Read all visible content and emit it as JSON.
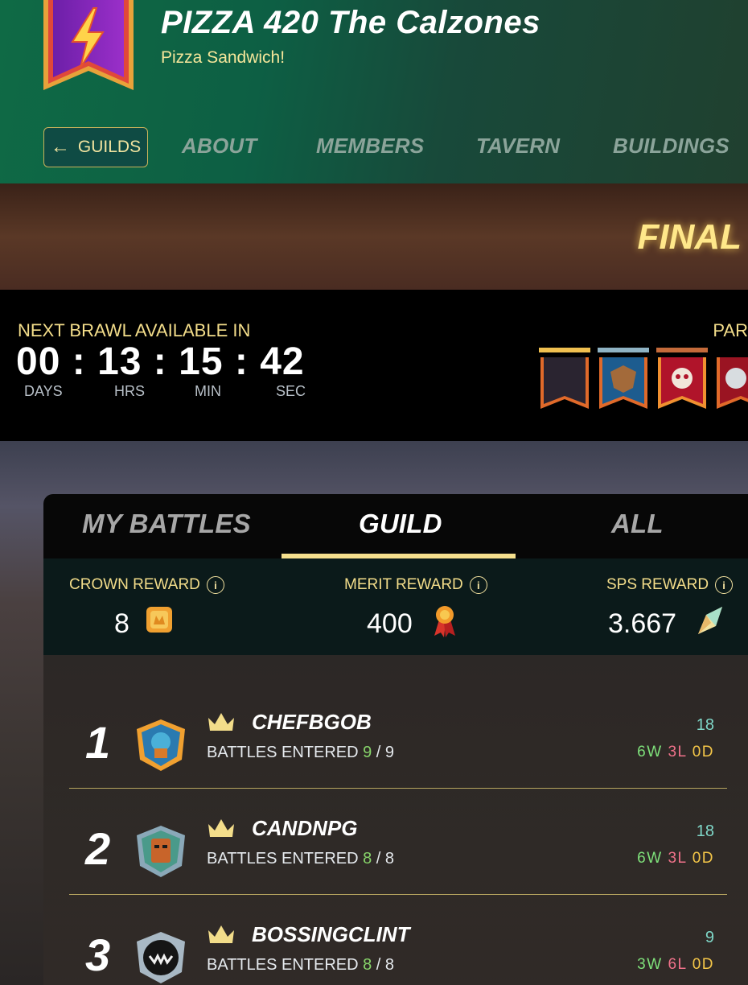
{
  "header": {
    "guild_name": "PIZZA 420 The Calzones",
    "motto": "Pizza Sandwich!",
    "back_label": "GUILDS",
    "nav": [
      "ABOUT",
      "MEMBERS",
      "TAVERN",
      "BUILDINGS"
    ]
  },
  "stage": {
    "label": "FINAL"
  },
  "timer": {
    "label": "NEXT BRAWL AVAILABLE IN",
    "days": "00",
    "hrs": "13",
    "min": "15",
    "sec": "42",
    "units": [
      "DAYS",
      "HRS",
      "MIN",
      "SEC"
    ],
    "participants_label": "PAR"
  },
  "tabs": {
    "items": [
      "MY BATTLES",
      "GUILD",
      "ALL"
    ],
    "active": "GUILD"
  },
  "rewards": {
    "crown": {
      "label": "CROWN REWARD",
      "value": "8"
    },
    "merit": {
      "label": "MERIT REWARD",
      "value": "400"
    },
    "sps": {
      "label": "SPS REWARD",
      "value": "3.667"
    }
  },
  "players": [
    {
      "rank": "1",
      "name": "CHEFBGOB",
      "battles_label": "BATTLES ENTERED",
      "entered": "9",
      "total": "9",
      "score": "18",
      "wins": "6",
      "losses": "3",
      "draws": "0"
    },
    {
      "rank": "2",
      "name": "CANDNPG",
      "battles_label": "BATTLES ENTERED",
      "entered": "8",
      "total": "8",
      "score": "18",
      "wins": "6",
      "losses": "3",
      "draws": "0"
    },
    {
      "rank": "3",
      "name": "BOSSINGCLINT",
      "battles_label": "BATTLES ENTERED",
      "entered": "8",
      "total": "8",
      "score": "9",
      "wins": "3",
      "losses": "6",
      "draws": "0"
    }
  ],
  "record_letters": {
    "w": "W",
    "l": "L",
    "d": "D"
  },
  "colors": {
    "accent_gold": "#f3dd8a",
    "header_green": "#0f6a45",
    "win": "#7ee07a",
    "loss": "#f0728a",
    "draw": "#f4c648"
  }
}
